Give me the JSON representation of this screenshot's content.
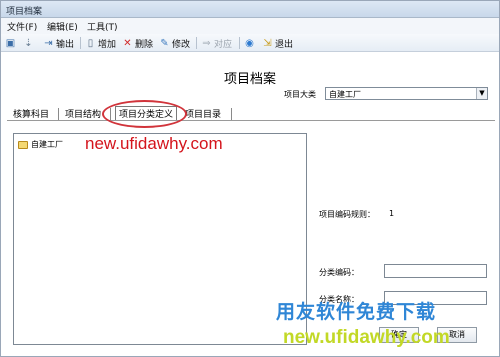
{
  "window": {
    "title": "项目档案"
  },
  "menu": {
    "items": [
      "文件(F)",
      "编辑(E)",
      "工具(T)"
    ]
  },
  "toolbar": {
    "export": "输出",
    "add": "增加",
    "delete": "删除",
    "modify": "修改",
    "match": "对应",
    "exit": "退出"
  },
  "page": {
    "title": "项目档案"
  },
  "category": {
    "label": "项目大类",
    "value": "自建工厂"
  },
  "tabs": [
    "核算科目",
    "项目结构",
    "项目分类定义",
    "项目目录"
  ],
  "tree": {
    "items": [
      "自建工厂"
    ]
  },
  "watermark": {
    "url": "new.ufidawhy.com",
    "brand_cn": "用友软件免费下载",
    "brand_url": "new.ufidawhy.com"
  },
  "form": {
    "rule_label": "项目编码规则：",
    "rule_value": "1",
    "code_label": "分类编码：",
    "code_value": "",
    "name_label": "分类名称：",
    "name_value": ""
  },
  "buttons": [
    "确定",
    "取消"
  ]
}
